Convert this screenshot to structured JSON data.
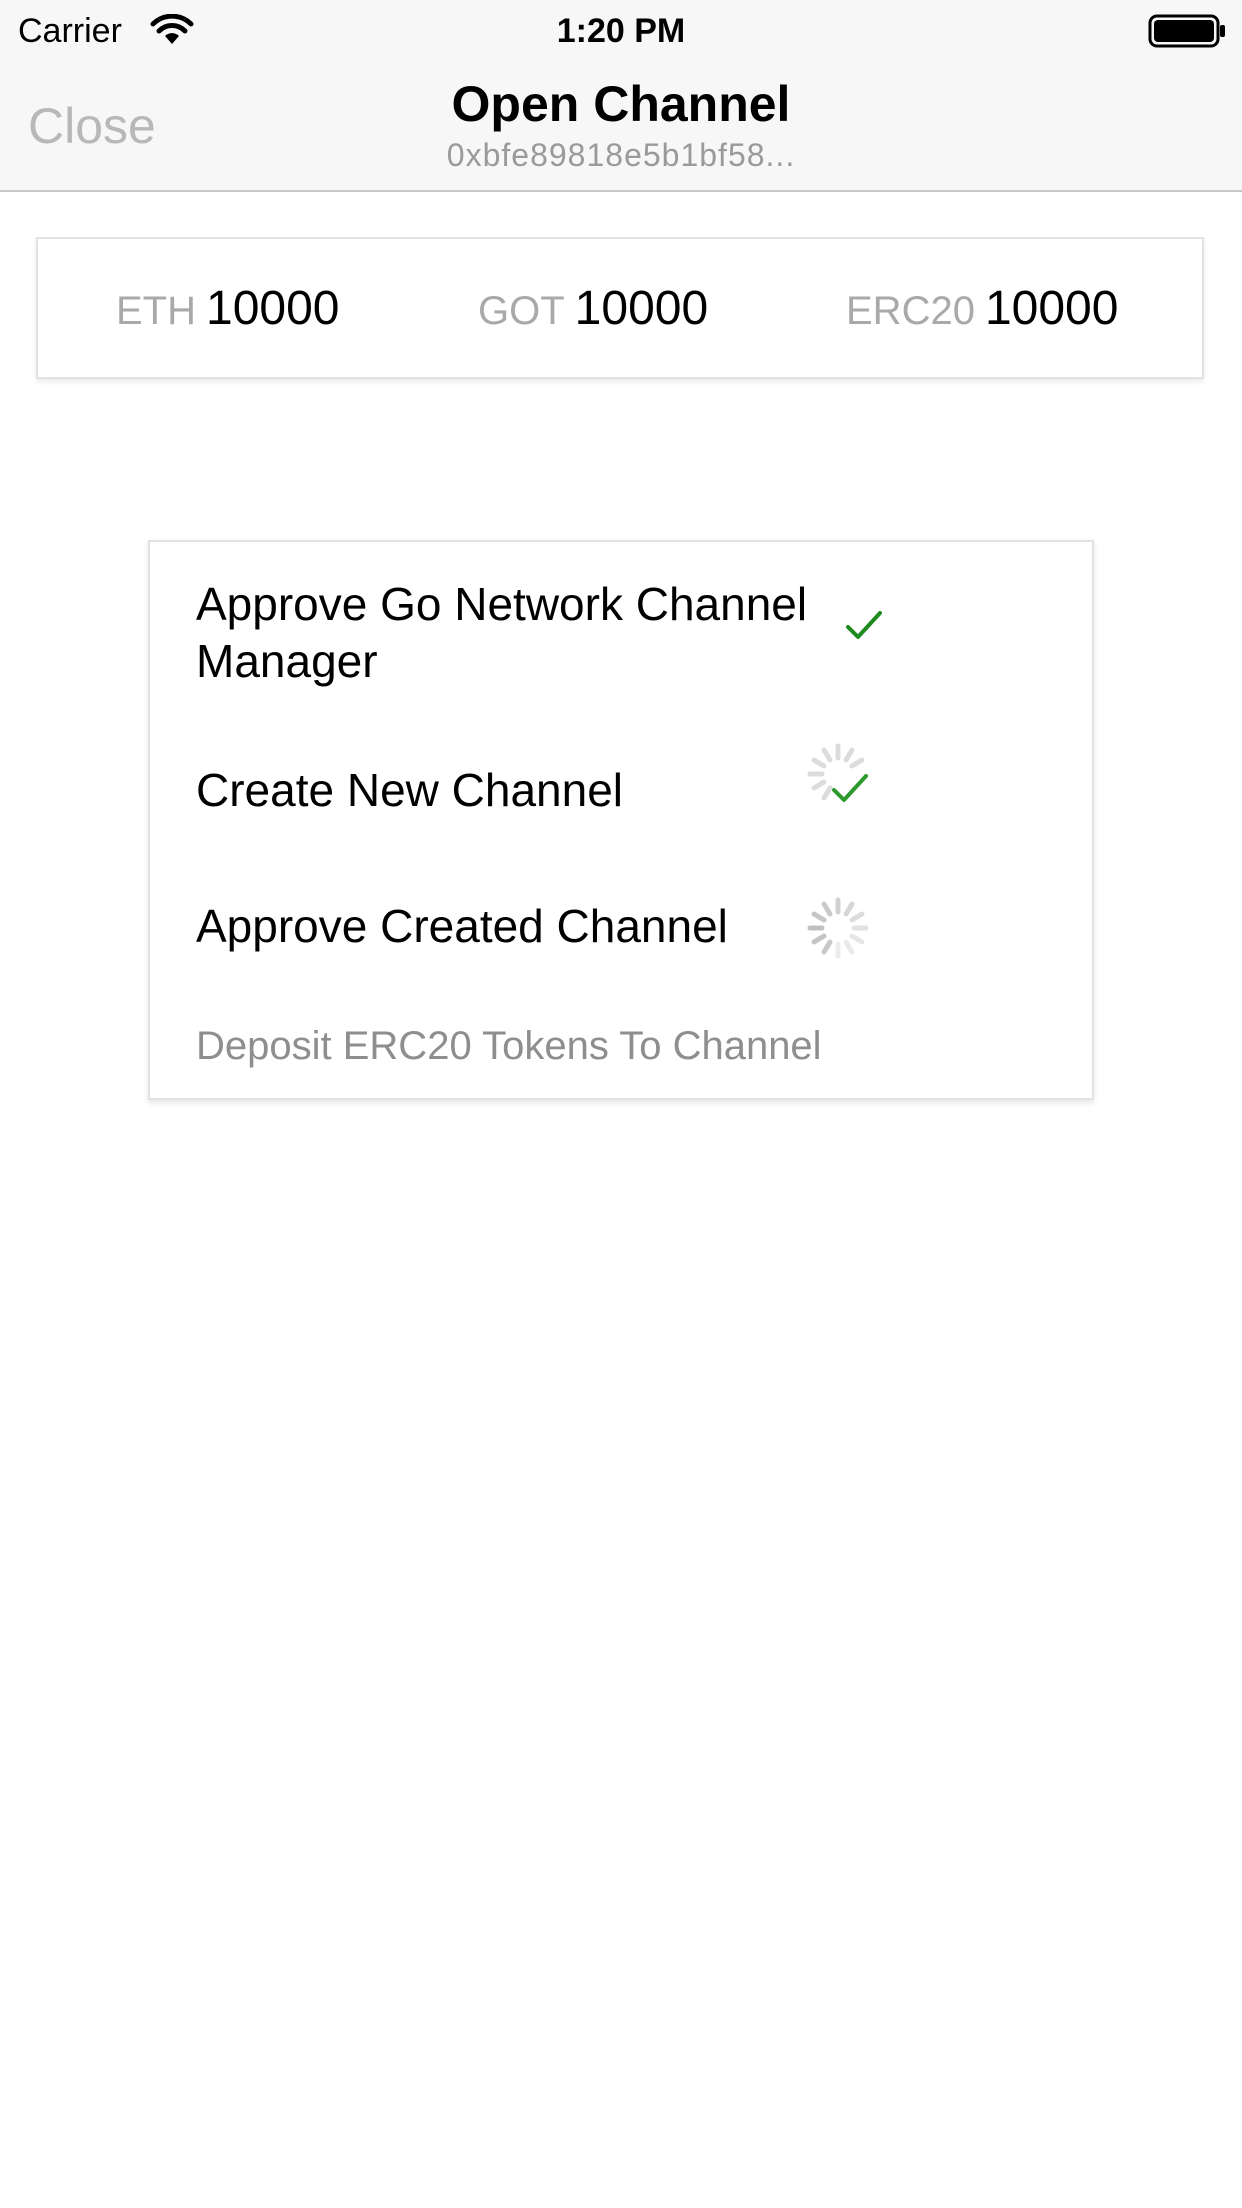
{
  "status_bar": {
    "carrier": "Carrier",
    "time": "1:20 PM",
    "icons": [
      "wifi-icon",
      "battery-icon"
    ]
  },
  "nav": {
    "close_label": "Close",
    "title": "Open Channel",
    "subtitle": "0xbfe89818e5b1bf58..."
  },
  "balances": [
    {
      "label": "ETH",
      "value": "10000"
    },
    {
      "label": "GOT",
      "value": "10000"
    },
    {
      "label": "ERC20",
      "value": "10000"
    }
  ],
  "steps": [
    {
      "label_line1": "Approve Go Network Channel",
      "label_line2": "Manager",
      "status": "done",
      "icon": "checkmark-icon"
    },
    {
      "label": "Create New Channel",
      "status": "done",
      "icon": "checkmark-icon"
    },
    {
      "label": "Approve Created Channel",
      "status": "in-progress",
      "icon": "spinner-icon"
    },
    {
      "label": "Deposit ERC20 Tokens To Channel",
      "status": "pending"
    }
  ],
  "colors": {
    "check": "#1f8a1f",
    "muted": "#a9a9a9",
    "nav_background": "#f7f7f7",
    "close": "#b8b8b8"
  }
}
